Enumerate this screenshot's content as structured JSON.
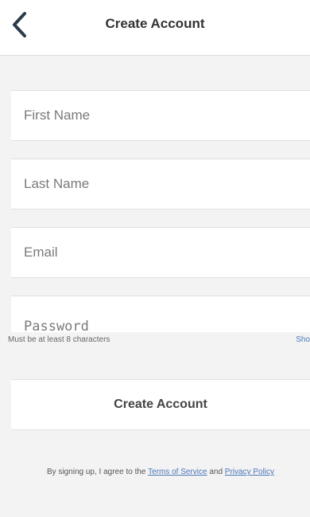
{
  "nav": {
    "back_icon": "chevron-left-icon",
    "title": "Create Account"
  },
  "form": {
    "first_name_placeholder": "First Name",
    "last_name_placeholder": "Last Name",
    "email_placeholder": "Email",
    "password_placeholder": "Password",
    "password_hint": "Must be at least 8 characters",
    "show_label": "Sho"
  },
  "submit": {
    "label": "Create Account"
  },
  "legal": {
    "prefix": "By signing up, I agree to the ",
    "terms_label": "Terms of Service",
    "middle": " and ",
    "privacy_label": "Privacy Policy"
  },
  "colors": {
    "link": "#4a78b8",
    "background": "#f3f3f3"
  }
}
